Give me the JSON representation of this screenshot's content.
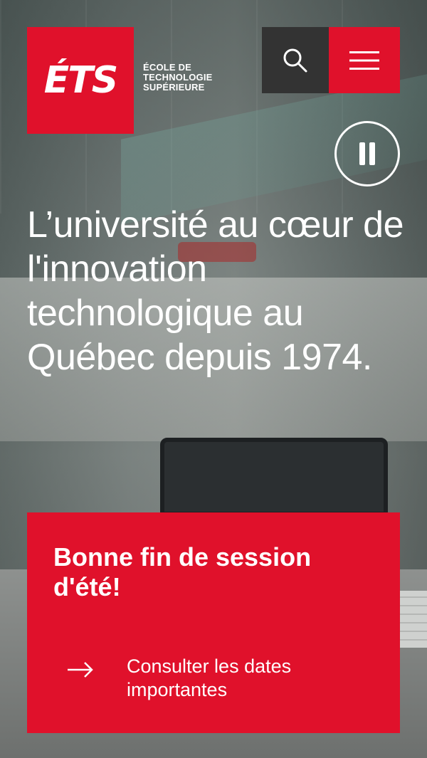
{
  "header": {
    "logo_mark": "ÉTS",
    "logo_text": [
      "ÉCOLE DE",
      "TECHNOLOGIE",
      "SUPÉRIEURE"
    ],
    "search_icon": "search-icon",
    "menu_icon": "hamburger-menu-icon"
  },
  "hero": {
    "pause_icon": "pause-icon",
    "title": "L’université au cœur de l'innovation technologique au Québec depuis 1974."
  },
  "announcement": {
    "title": "Bonne fin de session d'été!",
    "link_label": "Consulter les dates importantes",
    "link_icon": "arrow-right-icon"
  },
  "colors": {
    "brand_red": "#e0112b",
    "search_bg": "#333333",
    "text": "#ffffff"
  }
}
